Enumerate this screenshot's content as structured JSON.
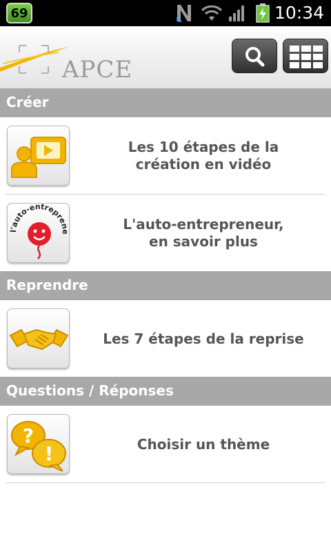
{
  "status_bar": {
    "notification_count": "69",
    "time": "10:34",
    "icons": [
      "n-signal-icon",
      "wifi-icon",
      "cell-signal-icon",
      "battery-charging-icon"
    ]
  },
  "header": {
    "logo_text": "APCE",
    "search_icon": "search-icon",
    "grid_icon": "grid-icon"
  },
  "sections": [
    {
      "title": "Créer",
      "items": [
        {
          "label_line1": "Les 10 étapes de la",
          "label_line2": "création en vidéo",
          "icon": "video-presenter-icon"
        },
        {
          "label_line1": "L'auto-entrepreneur,",
          "label_line2": "en savoir plus",
          "icon": "auto-entrepreneur-logo",
          "icon_text": "l'auto-entrepreneur"
        }
      ]
    },
    {
      "title": "Reprendre",
      "items": [
        {
          "label_line1": "Les 7 étapes de la reprise",
          "icon": "handshake-icon"
        }
      ]
    },
    {
      "title": "Questions / Réponses",
      "items": [
        {
          "label_line1": "Choisir un thème",
          "icon": "question-speech-bubbles-icon"
        }
      ]
    }
  ],
  "colors": {
    "section_bg": "#a8a8a8",
    "section_text": "#ffffff",
    "item_text": "#555555",
    "accent_yellow": "#f2b400"
  }
}
